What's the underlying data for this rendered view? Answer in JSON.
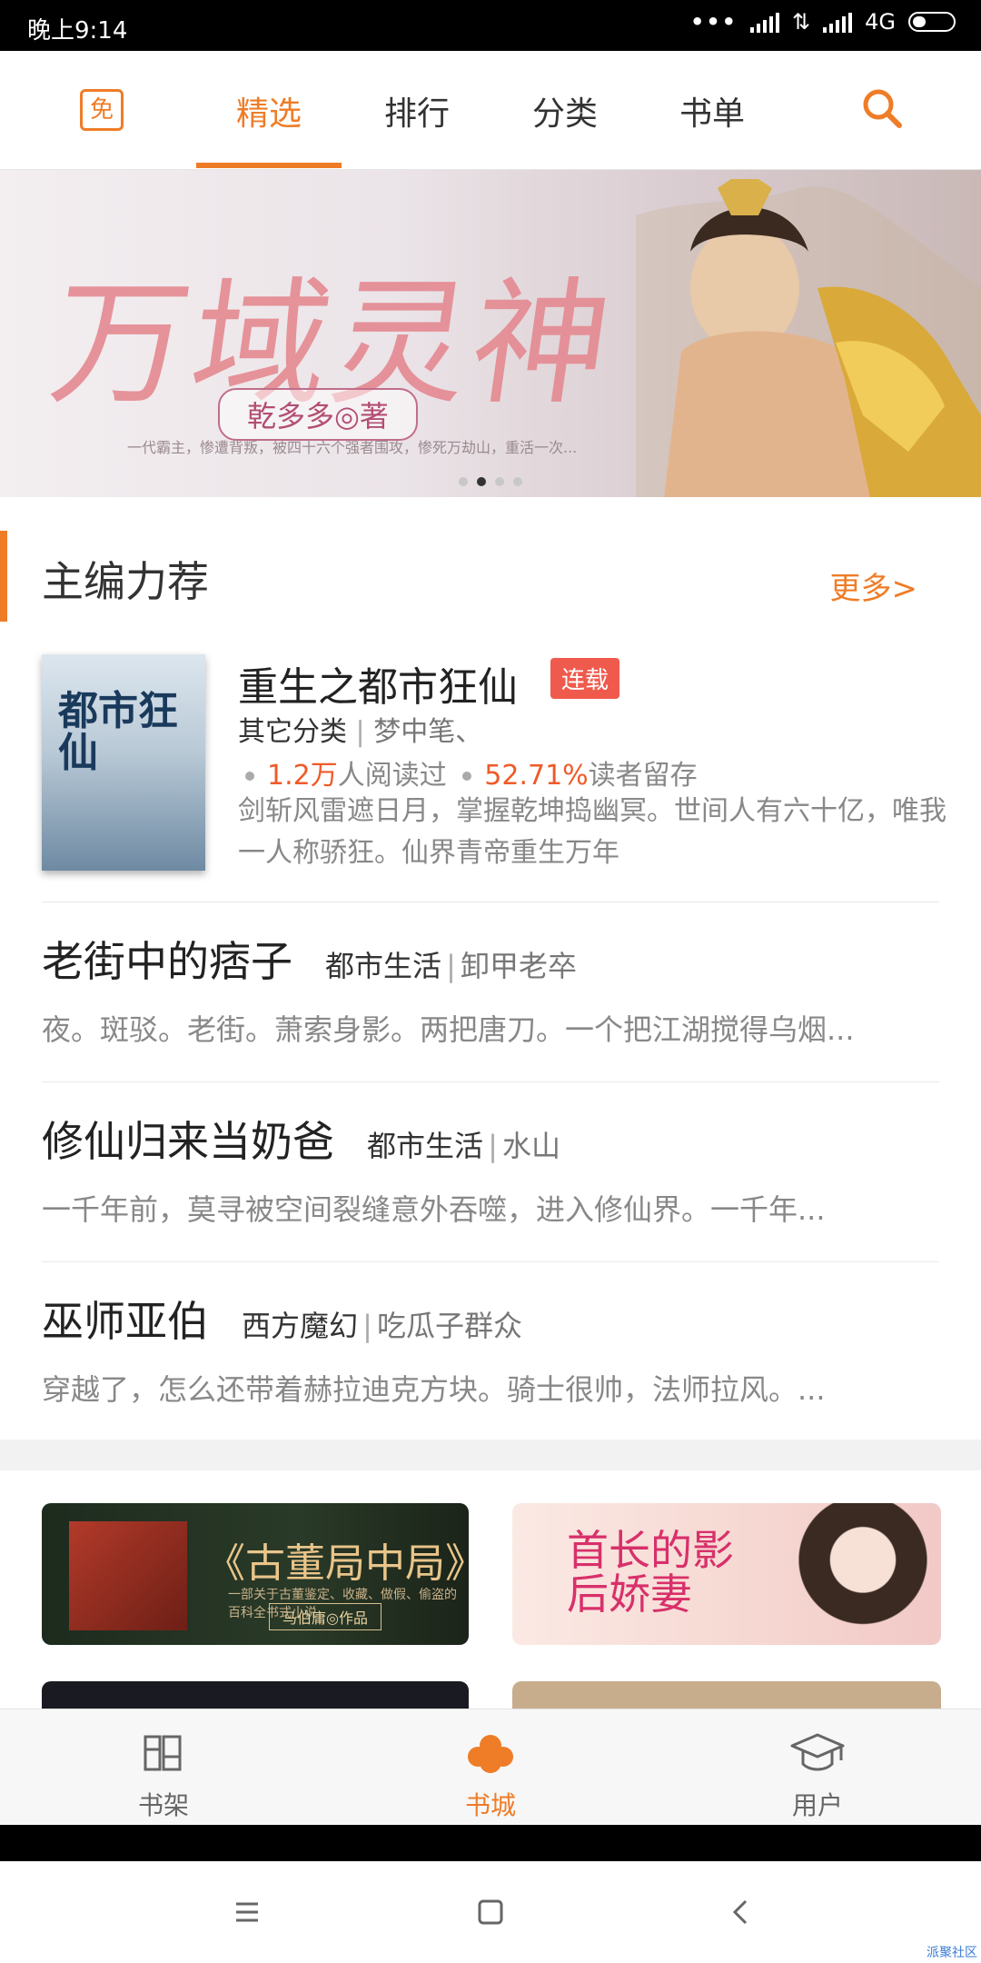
{
  "status_bar": {
    "time": "晚上9:14",
    "network": "4G"
  },
  "top_nav": {
    "logo_text": "免",
    "tabs": [
      {
        "label": "精选",
        "active": true
      },
      {
        "label": "排行",
        "active": false
      },
      {
        "label": "分类",
        "active": false
      },
      {
        "label": "书单",
        "active": false
      }
    ],
    "search_icon": "search-icon",
    "accent_color": "#ef7c27"
  },
  "banner": {
    "title": "万域灵神",
    "author": "乾多多◎著",
    "subtitle": "一代霸主，惨遭背叛，被四十六个强者围攻，惨死万劫山，重活一次...",
    "page_count": 4,
    "active_page": 1
  },
  "section": {
    "title": "主编力荐",
    "more": "更多>"
  },
  "featured": {
    "cover_text": "都市狂仙",
    "title": "重生之都市狂仙",
    "badge": "连载",
    "category": "其它分类",
    "separator": "|",
    "author": "梦中笔、",
    "readers": "1.2万",
    "readers_suffix": "人阅读过",
    "retention": "52.71%",
    "retention_suffix": "读者留存",
    "description": "剑斩风雷遮日月，掌握乾坤捣幽冥。世间人有六十亿，唯我一人称骄狂。仙界青帝重生万年"
  },
  "books": [
    {
      "title": "老街中的痞子",
      "category": "都市生活",
      "separator": "|",
      "author": "卸甲老卒",
      "description": "夜。斑驳。老街。萧索身影。两把唐刀。一个把江湖搅得乌烟..."
    },
    {
      "title": "修仙归来当奶爸",
      "category": "都市生活",
      "separator": "|",
      "author": "水山",
      "description": "一千年前，莫寻被空间裂缝意外吞噬，进入修仙界。一千年..."
    },
    {
      "title": "巫师亚伯",
      "category": "西方魔幻",
      "separator": "|",
      "author": "吃瓜子群众",
      "description": "穿越了，怎么还带着赫拉迪克方块。骑士很帅，法师拉风。..."
    }
  ],
  "promos": [
    {
      "title": "《古董局中局》",
      "subtitle": "一部关于古董鉴定、收藏、做假、偷盗的百科全书式小说",
      "author": "马伯庸◎作品"
    },
    {
      "title": "首长的影后娇妻"
    }
  ],
  "bottom_tabs": [
    {
      "label": "书架",
      "icon": "bookshelf-icon",
      "active": false
    },
    {
      "label": "书城",
      "icon": "cloud-icon",
      "active": true
    },
    {
      "label": "用户",
      "icon": "graduation-cap-icon",
      "active": false
    }
  ],
  "watermark": "派聚社区"
}
